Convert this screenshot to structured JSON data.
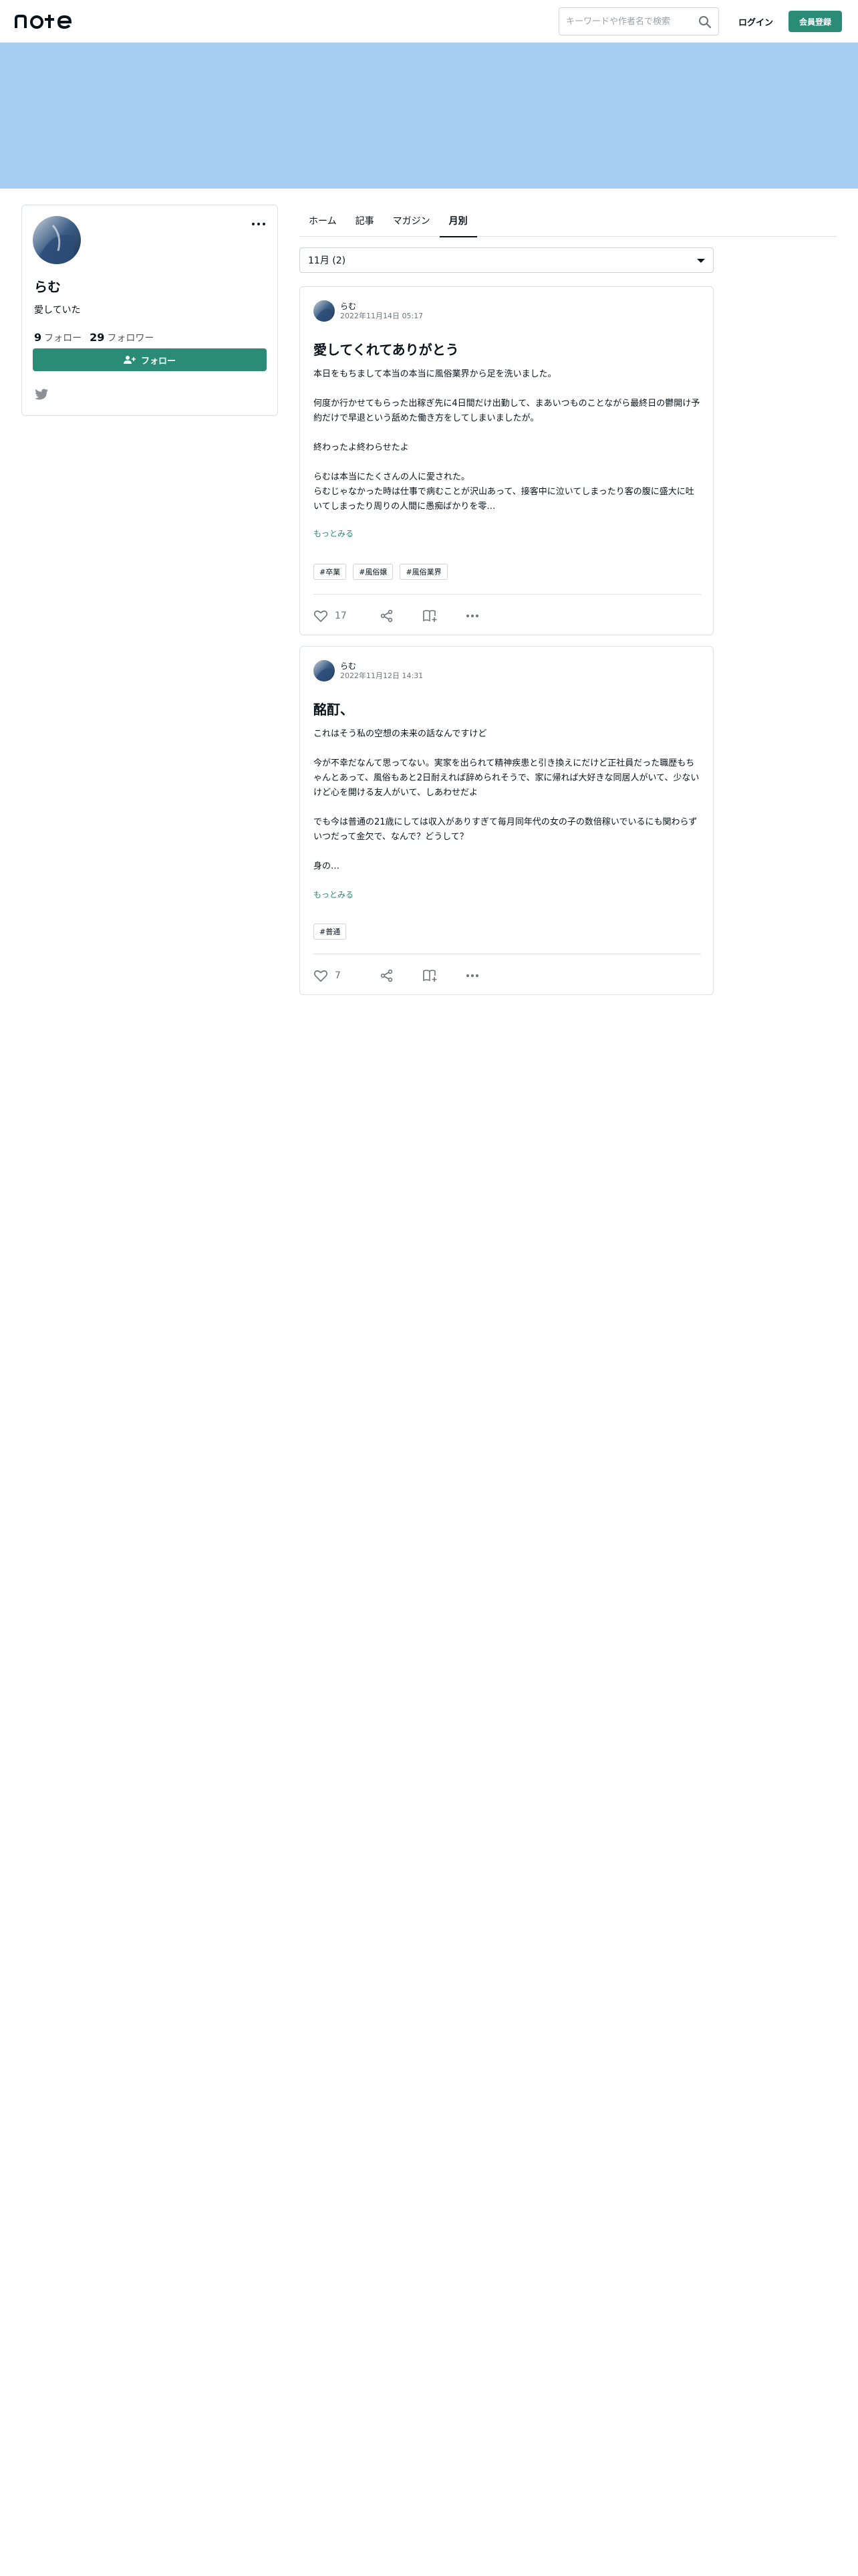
{
  "header": {
    "logo_text": "note",
    "search_placeholder": "キーワードや作者名で検索",
    "login_label": "ログイン",
    "signup_label": "会員登録"
  },
  "colors": {
    "accent": "#2a8b76",
    "cover": "#a7cdf0"
  },
  "profile": {
    "name": "らむ",
    "bio": "愛していた",
    "following_count": "9",
    "following_label": "フォロー",
    "followers_count": "29",
    "followers_label": "フォロワー",
    "follow_button": "フォロー"
  },
  "tabs": [
    {
      "label": "ホーム"
    },
    {
      "label": "記事"
    },
    {
      "label": "マガジン"
    },
    {
      "label": "月別"
    }
  ],
  "active_tab": "月別",
  "month_select": {
    "value": "11月 (2)"
  },
  "articles": [
    {
      "author": "らむ",
      "date": "2022年11月14日 05:17",
      "title": "愛してくれてありがとう",
      "body": "本日をもちまして本当の本当に風俗業界から足を洗いました。\n\n何度か行かせてもらった出稼ぎ先に4日間だけ出勤して、まあいつものことながら最終日の鬱開け予約だけで早退という舐めた働き方をしてしまいましたが。\n\n終わったよ終わらせたよ\n\nらむは本当にたくさんの人に愛された。\nらむじゃなかった時は仕事で病むことが沢山あって、接客中に泣いてしまったり客の腹に盛大に吐いてしまったり周りの人間に愚痴ばかりを零…",
      "more_label": "もっとみる",
      "hashtags": [
        "#卒業",
        "#風俗嬢",
        "#風俗業界"
      ],
      "likes": "17"
    },
    {
      "author": "らむ",
      "date": "2022年11月12日 14:31",
      "title": "酩酊、",
      "body": "これはそう私の空想の未来の話なんですけど\n\n今が不幸だなんて思ってない。実家を出られて精神疾患と引き換えにだけど正社員だった職歴もちゃんとあって、風俗もあと2日耐えれば辞められそうで、家に帰れば大好きな同居人がいて、少ないけど心を開ける友人がいて、しあわせだよ\n\nでも今は普通の21歳にしては収入がありすぎて毎月同年代の女の子の数倍稼いでいるにも関わらずいつだって金欠で、なんで？どうして？\n\n身の…",
      "more_label": "もっとみる",
      "hashtags": [
        "#普通"
      ],
      "likes": "7"
    }
  ]
}
